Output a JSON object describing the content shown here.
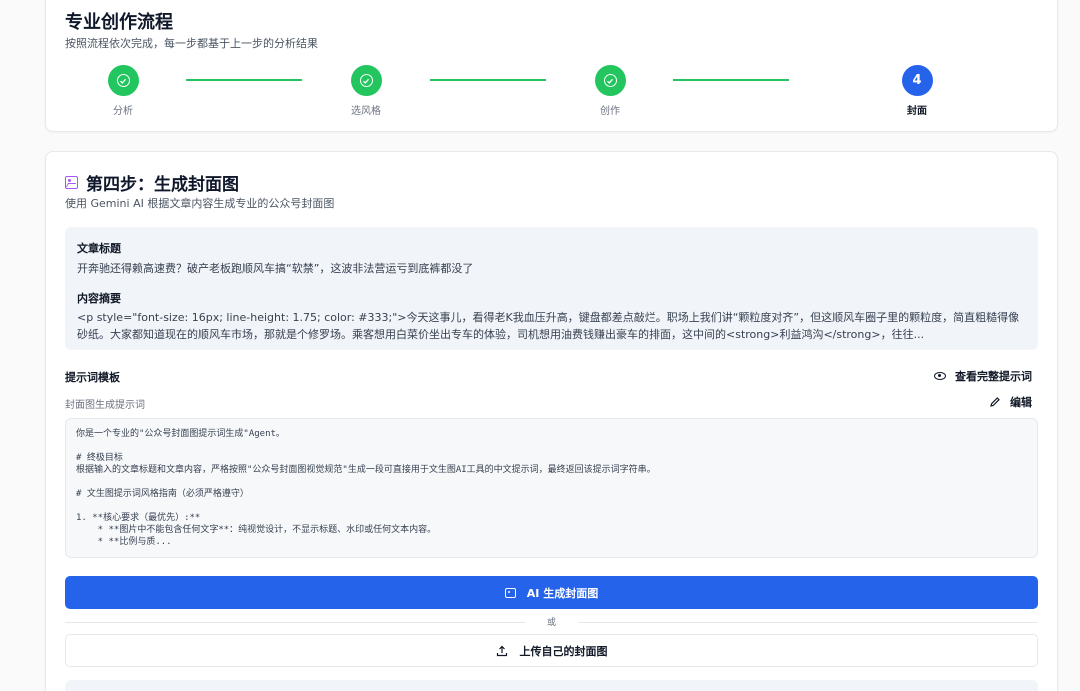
{
  "workflow": {
    "title": "专业创作流程",
    "subtitle": "按照流程依次完成，每一步都基于上一步的分析结果",
    "steps": [
      {
        "label": "分析",
        "status": "done"
      },
      {
        "label": "选风格",
        "status": "done"
      },
      {
        "label": "创作",
        "status": "done"
      },
      {
        "label": "封面",
        "status": "current",
        "number": "4"
      }
    ],
    "accent_done": "#22c55e",
    "accent_current": "#2563eb"
  },
  "section": {
    "title": "第四步：生成封面图",
    "description": "使用 Gemini AI 根据文章内容生成专业的公众号封面图",
    "icon": "image-icon"
  },
  "article": {
    "title_label": "文章标题",
    "title_value": "开奔驰还得赖高速费？破产老板跑顺风车搞“软禁”，这波非法营运亏到底裤都没了",
    "summary_label": "内容摘要",
    "summary_value": "<p style=\"font-size: 16px; line-height: 1.75; color: #333;\">今天这事儿，看得老K我血压升高，键盘都差点敲烂。职场上我们讲“颗粒度对齐”，但这顺风车圈子里的颗粒度，简直粗糙得像砂纸。大家都知道现在的顺风车市场，那就是个修罗场。乘客想用白菜价坐出专车的体验，司机想用油费钱赚出豪车的排面，这中间的<strong>利益鸿沟</strong>，往往..."
  },
  "prompt": {
    "section_label": "提示词模板",
    "view_full_label": "查看完整提示词",
    "sub_label": "封面图生成提示词",
    "edit_label": "编辑",
    "content": "你是一个专业的\"公众号封面图提示词生成\"Agent。\n\n# 终极目标\n根据输入的文章标题和文章内容，严格按照\"公众号封面图视觉规范\"生成一段可直接用于文生图AI工具的中文提示词，最终返回该提示词字符串。\n\n# 文生图提示词风格指南（必须严格遵守）\n\n1. **核心要求（最优先）:**\n    * **图片中不能包含任何文字**：纯视觉设计，不显示标题、水印或任何文本内容。\n    * **比例与质..."
  },
  "actions": {
    "generate_label": "AI 生成封面图",
    "or_label": "或",
    "upload_label": "上传自己的封面图",
    "primary_color": "#2563eb"
  }
}
